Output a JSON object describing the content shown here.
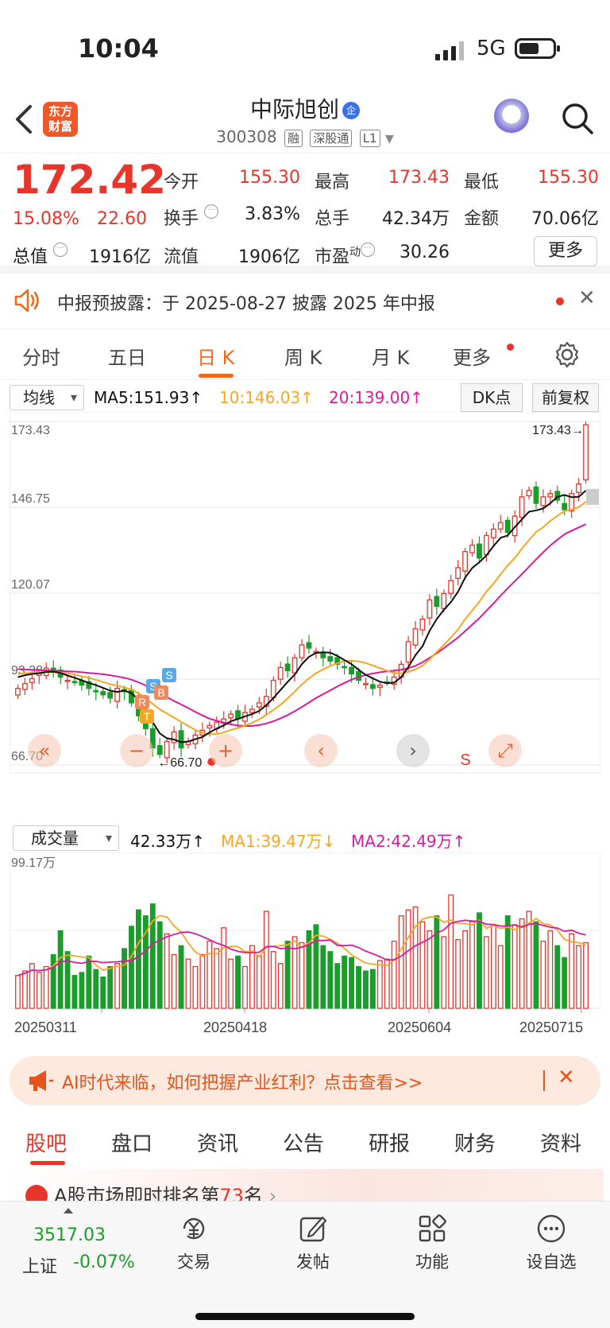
{
  "status_bar": {
    "time": "10:04",
    "network": "5G",
    "battery_level": 0.55
  },
  "header": {
    "stock_name": "中际旭创",
    "qi_badge": "企",
    "code": "300308",
    "tags": [
      "融",
      "深股通",
      "L1"
    ],
    "logo_text": [
      "东方",
      "财富"
    ]
  },
  "quote": {
    "price": "172.42",
    "pct": "15.08%",
    "change": "22.60",
    "open_label": "今开",
    "open": "155.30",
    "high_label": "最高",
    "high": "173.43",
    "low_label": "最低",
    "low": "155.30",
    "turnover_label": "换手",
    "turnover": "3.83%",
    "volume_label": "总手",
    "volume": "42.34万",
    "amount_label": "金额",
    "amount": "70.06亿",
    "mktcap_label": "总值",
    "mktcap": "1916亿",
    "float_label": "流值",
    "float": "1906亿",
    "pe_label": "市盈",
    "pe_sup": "动",
    "pe": "30.26",
    "more_button": "更多"
  },
  "notice": {
    "text": "中报预披露：于 2025-08-27 披露 2025 年中报"
  },
  "period_tabs": [
    "分时",
    "五日",
    "日 K",
    "周 K",
    "月 K",
    "更多"
  ],
  "active_period": "日 K",
  "indicator": {
    "select": "均线",
    "ma5": "MA5:151.93",
    "ma10": "10:146.03",
    "ma20": "20:139.00",
    "dk_button": "DK点",
    "adjust_button": "前复权"
  },
  "colors": {
    "up": "#e8352b",
    "down": "#1a9d2a",
    "ma5": "#111111",
    "ma10": "#f5a623",
    "ma20": "#d81b9e",
    "accent": "#f06a1c"
  },
  "chart_data": [
    {
      "type": "candlestick",
      "title": "",
      "y_ticks": [
        "173.43",
        "146.75",
        "120.07",
        "93.38",
        "66.70"
      ],
      "ylim": [
        66.7,
        173.43
      ],
      "max_label": "173.43→",
      "min_label": "←66.70",
      "markers": [
        "R",
        "T",
        "S",
        "B",
        "S"
      ],
      "signal_label": "S",
      "closes": [
        90.5,
        92,
        93.5,
        95.2,
        96.8,
        95.5,
        94,
        93,
        92.5,
        91.5,
        90.5,
        89.5,
        88.5,
        87.5,
        90.5,
        89.5,
        86,
        82,
        78,
        72,
        70,
        74,
        77,
        72,
        74,
        76,
        77.5,
        79,
        80,
        81,
        82.5,
        81,
        83,
        84,
        86,
        88,
        93,
        97,
        96,
        100,
        104,
        103,
        102,
        100,
        99,
        98,
        97,
        95,
        93,
        92,
        90.5,
        91.5,
        92.5,
        94,
        98,
        105,
        109,
        112,
        118,
        116,
        120,
        124,
        128,
        133,
        135,
        131,
        138,
        140,
        142,
        139,
        144,
        150,
        152,
        148,
        150,
        151,
        149,
        146,
        151,
        154,
        172.42
      ],
      "ma5_line": [
        94,
        94.6,
        95,
        95.2,
        95.6,
        95.7,
        95.3,
        94.5,
        93.8,
        93,
        92.2,
        91.5,
        90.7,
        89.8,
        89.4,
        89.8,
        89,
        87,
        84.5,
        80,
        76.5,
        75,
        74.6,
        73.8,
        74,
        74.7,
        75.4,
        76.8,
        78,
        79,
        80.3,
        81,
        81.8,
        82.5,
        83.5,
        85.3,
        87.5,
        90,
        92.5,
        94.8,
        98,
        100.3,
        101.5,
        101.7,
        101.6,
        100.6,
        99.3,
        98,
        96.3,
        94.7,
        93.6,
        92.6,
        92.1,
        92.3,
        94,
        97.1,
        100.8,
        103.6,
        108.4,
        112,
        114.9,
        117.3,
        120.5,
        124.9,
        127.9,
        129.7,
        131.8,
        134.7,
        137.3,
        138,
        140.6,
        143,
        145.4,
        145.8,
        146.4,
        148,
        150,
        150.6,
        149.9,
        150,
        151.93
      ],
      "ma10_line": [
        95,
        95.2,
        95.3,
        95.4,
        95.5,
        95.5,
        95.4,
        95.2,
        94.8,
        94.3,
        93.8,
        93.1,
        92.5,
        91.8,
        91.3,
        90.8,
        90.2,
        89,
        87.5,
        85.7,
        84,
        82.7,
        81.4,
        80.1,
        78.8,
        77.6,
        76.7,
        76.3,
        76.3,
        76.8,
        77.6,
        78.2,
        78.9,
        79.8,
        80.9,
        82.3,
        83.8,
        85.4,
        87.4,
        89.5,
        91.7,
        93.6,
        95.2,
        96.4,
        97.5,
        98.3,
        99,
        99.1,
        98.9,
        98.4,
        97.6,
        96.8,
        96,
        95.2,
        95.2,
        95.6,
        96.4,
        97.5,
        99.5,
        101.8,
        104,
        106.3,
        108.8,
        112,
        114.7,
        117.4,
        120.6,
        123,
        126,
        128.7,
        131,
        133.9,
        136.6,
        139.1,
        140.6,
        142.5,
        144.1,
        145.6,
        146,
        146.8,
        148.5
      ],
      "ma20_line": [
        96.5,
        96.4,
        96.3,
        96.2,
        96.1,
        96,
        95.9,
        95.8,
        95.7,
        95.5,
        95.3,
        95.1,
        94.9,
        94.6,
        94.2,
        93.8,
        93.2,
        92.4,
        91.4,
        90.2,
        88.9,
        87.8,
        86.6,
        85.5,
        84.4,
        83.2,
        82.1,
        81.1,
        80.4,
        79.9,
        79.3,
        79,
        78.8,
        78.8,
        79.1,
        79.6,
        80.3,
        81.2,
        82.2,
        83.4,
        84.7,
        86.1,
        87.5,
        88.7,
        89.9,
        91.1,
        92.2,
        93.2,
        94,
        94.7,
        95.1,
        95.5,
        95.8,
        96,
        96.3,
        96.8,
        97.5,
        98.6,
        100,
        101.4,
        103,
        104.6,
        106.3,
        108.3,
        110.3,
        112.3,
        114.6,
        116.9,
        119.3,
        121.6,
        123.8,
        126,
        128.3,
        130.6,
        132.8,
        134.9,
        136.7,
        138.4,
        139.5,
        140.5,
        141.5
      ],
      "x_labels": [
        "20250311",
        "20250418",
        "20250604",
        "20250715"
      ]
    },
    {
      "type": "bar",
      "title": "",
      "y_max_label": "99.17万",
      "ylim": [
        0,
        99.17
      ],
      "values": [
        22,
        25,
        30,
        24,
        28,
        36,
        52,
        38,
        22,
        24,
        35,
        26,
        21,
        28,
        30,
        40,
        55,
        66,
        62,
        70,
        58,
        50,
        36,
        42,
        33,
        28,
        36,
        45,
        40,
        54,
        33,
        35,
        28,
        42,
        35,
        65,
        38,
        30,
        45,
        48,
        44,
        52,
        56,
        42,
        38,
        30,
        35,
        34,
        28,
        25,
        26,
        32,
        33,
        45,
        62,
        66,
        68,
        58,
        52,
        62,
        48,
        76,
        46,
        52,
        58,
        64,
        48,
        56,
        42,
        62,
        56,
        60,
        65,
        58,
        45,
        52,
        42,
        34,
        50,
        42,
        44
      ],
      "volume_today": "42.33万",
      "ma1": "MA1:39.47万",
      "ma2": "MA2:42.49万",
      "x_labels": [
        "20250311",
        "20250418",
        "20250604",
        "20250715"
      ]
    }
  ],
  "volume_select": "成交量",
  "ad": {
    "text": "AI时代来临，如何把握产业红利？点击查看>>"
  },
  "bottom_tabs": [
    "股吧",
    "盘口",
    "资讯",
    "公告",
    "研报",
    "财务",
    "资料"
  ],
  "rank": {
    "prefix": "A股市场即时排名第",
    "rank": "73",
    "suffix": "名"
  },
  "dock": {
    "index_value": "3517.03",
    "index_name": "上证",
    "index_change": "-0.07%",
    "items": [
      "交易",
      "发帖",
      "功能",
      "设自选"
    ]
  }
}
